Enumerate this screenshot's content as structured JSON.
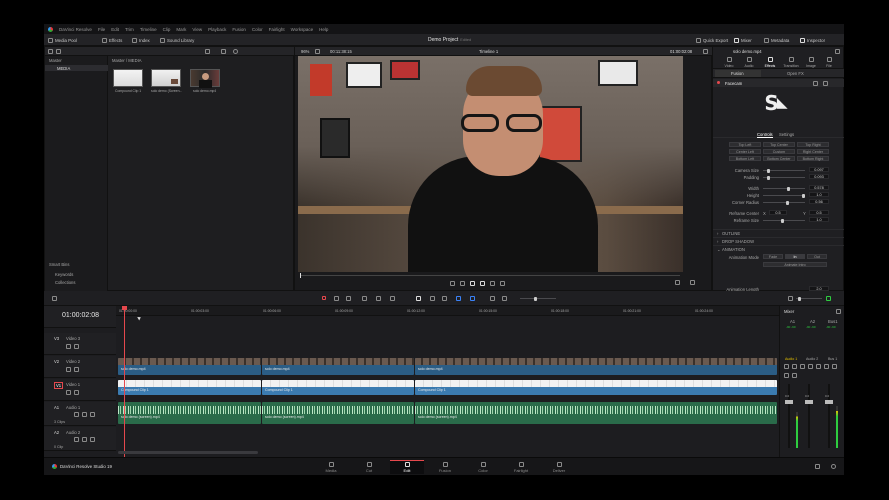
{
  "menubar": {
    "items": [
      "DaVinci Resolve",
      "File",
      "Edit",
      "Trim",
      "Timeline",
      "Clip",
      "Mark",
      "View",
      "Playback",
      "Fusion",
      "Color",
      "Fairlight",
      "Workspace",
      "Help"
    ]
  },
  "toolbar": {
    "media_pool": "Media Pool",
    "effects": "Effects",
    "index": "Index",
    "sound_library": "Sound Library",
    "project_title": "Demo Project",
    "project_status": "Edited",
    "quick_export": "Quick Export",
    "mixer": "Mixer",
    "metadata": "Metadata",
    "inspector": "Inspector"
  },
  "media_pool": {
    "bin_master": "Master",
    "bin_media": "MEDIA",
    "path": "Master / MEDIA",
    "clips": [
      "Compound Clip 1",
      "solo demo (Screen...",
      "solo demo.mp4"
    ],
    "smart_bins": "Smart Bins",
    "keywords": "Keywords",
    "collections": "Collections"
  },
  "viewer": {
    "zoom": "96%",
    "source_timecode": "00:11:38:15",
    "timeline_name": "Timeline 1",
    "timecode": "01:00:02:08"
  },
  "inspector": {
    "clip_name": "solo demo.mp4",
    "tabs": [
      "Video",
      "Audio",
      "Effects",
      "Transition",
      "Image",
      "File"
    ],
    "active_tab": "Effects",
    "subtabs": [
      "Fusion",
      "Open FX"
    ],
    "effect_name": "Facecam",
    "logo_text": "S",
    "inner_tabs": [
      "Controls",
      "Settings"
    ],
    "positions": [
      "Top Left",
      "Top Center",
      "Top Right",
      "Center Left",
      "Custom",
      "Right Center",
      "Bottom Left",
      "Bottom Center",
      "Bottom Right"
    ],
    "params": [
      {
        "label": "Camera Size",
        "value": "0.097"
      },
      {
        "label": "Padding",
        "value": "0.093"
      },
      {
        "label": "Width",
        "value": "0.578"
      },
      {
        "label": "Height",
        "value": "1.0"
      },
      {
        "label": "Corner Radius",
        "value": "0.56"
      }
    ],
    "reframe_center_label": "Reframe Center",
    "reframe_x_label": "X",
    "reframe_x": "0.5",
    "reframe_y_label": "Y",
    "reframe_y": "0.5",
    "reframe_size_label": "Reframe Size",
    "reframe_size": "1.0",
    "sections": [
      "OUTLINE",
      "DROP SHADOW",
      "ANIMATION"
    ],
    "animation_mode_label": "Animation Mode",
    "animation_modes": [
      "Fade",
      "In",
      "Out"
    ],
    "animate_intro": "Animate Intro",
    "animation_length_label": "Animation Length",
    "animation_length": "2.0"
  },
  "timeline": {
    "timecode": "01:00:02:08",
    "ruler": [
      "01:00:00:00",
      "01:00:03:00",
      "01:00:06:00",
      "01:00:09:00",
      "01:00:12:00",
      "01:00:15:00",
      "01:00:18:00",
      "01:00:21:00",
      "01:00:24:00"
    ],
    "tracks": [
      {
        "id": "V3",
        "name": "Video 3",
        "clips": ""
      },
      {
        "id": "V2",
        "name": "Video 2",
        "clips": ""
      },
      {
        "id": "V1",
        "name": "Video 1",
        "clips": ""
      },
      {
        "id": "A1",
        "name": "Audio 1",
        "clips": "3 Clips"
      },
      {
        "id": "A2",
        "name": "Audio 2",
        "clips": "0 Clip"
      }
    ],
    "clip_v2": "solo demo.mp4",
    "clip_v1": "Compound Clip 1",
    "clip_a1": "solo demo (screen).mp4"
  },
  "mixer": {
    "title": "Mixer",
    "channels": [
      "A1",
      "A2",
      "Bus1"
    ],
    "channel_values": [
      "-90 -90",
      "-90 -90",
      "-90 -90"
    ],
    "strip_labels": [
      "Audio 1",
      "Audio 2",
      "Bus 1"
    ],
    "fader_values": [
      "0.0",
      "0.0",
      "0.0"
    ]
  },
  "pagebar": {
    "app_name": "DaVinci Resolve Studio 19",
    "pages": [
      "Media",
      "Cut",
      "Edit",
      "Fusion",
      "Color",
      "Fairlight",
      "Deliver"
    ],
    "active_page": "Edit"
  },
  "colors": {
    "accent": "#e5484d",
    "video_clip": "#2b5d85",
    "compound_clip": "#3b7bb0",
    "audio_clip": "#2a6b4a"
  }
}
